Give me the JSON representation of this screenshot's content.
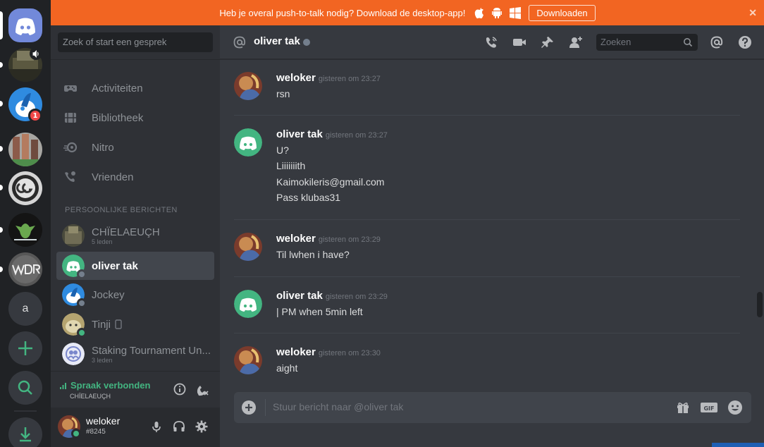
{
  "banner": {
    "text": "Heb je overal push-to-talk nodig? Download de desktop-app!",
    "download_label": "Downloaden",
    "close_glyph": "✕",
    "platform_icons": [
      "apple-icon",
      "android-icon",
      "windows-icon"
    ],
    "color": "#f26522"
  },
  "servers": {
    "home_icon": "discord-logo-icon",
    "items": [
      {
        "name": "server-1",
        "badge": ""
      },
      {
        "name": "server-2",
        "badge": "1"
      },
      {
        "name": "server-3",
        "badge": ""
      },
      {
        "name": "server-4",
        "badge": ""
      },
      {
        "name": "server-5-allwealth",
        "badge": ""
      },
      {
        "name": "server-6-wdr",
        "badge": ""
      }
    ],
    "letter_server": "a",
    "add_icon": "plus-icon",
    "explore_icon": "search-icon",
    "download_icon": "download-icon"
  },
  "sidebar": {
    "search_placeholder": "Zoek of start een gesprek",
    "nav": [
      {
        "label": "Activiteiten",
        "icon": "gamepad-icon"
      },
      {
        "label": "Bibliotheek",
        "icon": "library-icon"
      },
      {
        "label": "Nitro",
        "icon": "nitro-icon"
      },
      {
        "label": "Vrienden",
        "icon": "friends-icon"
      }
    ],
    "dm_header": "PERSOONLIJKE BERICHTEN",
    "dms": [
      {
        "name": "CHÏELAEUÇH",
        "sub": "5 leden",
        "status": ""
      },
      {
        "name": "oliver tak",
        "sub": "",
        "status": "offline"
      },
      {
        "name": "Jockey",
        "sub": "",
        "status": "offline"
      },
      {
        "name": "Tinji",
        "sub": "",
        "status": "online"
      },
      {
        "name": "Staking Tournament Un...",
        "sub": "3 leden",
        "status": ""
      }
    ]
  },
  "voice": {
    "label": "Spraak verbonden",
    "channel": "CHÏELAEUÇH"
  },
  "user": {
    "name": "weloker",
    "tag": "#8245"
  },
  "chat": {
    "title": "oliver tak",
    "search_placeholder": "Zoeken",
    "composer_placeholder": "Stuur bericht naar @oliver tak",
    "messages": [
      {
        "author": "weloker",
        "time": "gisteren om 23:27",
        "lines": [
          "rsn"
        ]
      },
      {
        "author": "oliver tak",
        "time": "gisteren om 23:27",
        "lines": [
          "U?",
          "Liiiiiiith",
          "Kaimokileris@gmail.com",
          "Pass klubas31"
        ]
      },
      {
        "author": "weloker",
        "time": "gisteren om 23:29",
        "lines": [
          "Til lwhen i have?"
        ]
      },
      {
        "author": "oliver tak",
        "time": "gisteren om 23:29",
        "lines": [
          "| PM when 5min left"
        ]
      },
      {
        "author": "weloker",
        "time": "gisteren om 23:30",
        "lines": [
          "aight"
        ]
      }
    ]
  },
  "colors": {
    "accent": "#7289da",
    "online": "#43b581",
    "badge": "#f04747",
    "dm_avatar_green": "#43b581"
  }
}
